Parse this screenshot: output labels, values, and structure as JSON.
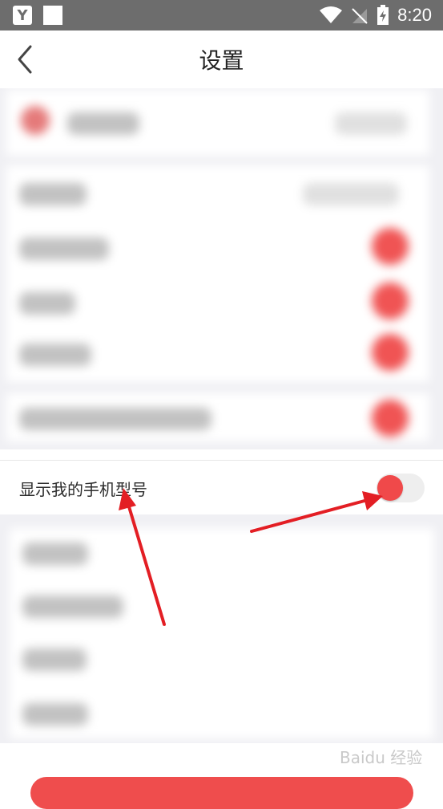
{
  "status_bar": {
    "time": "8:20"
  },
  "header": {
    "title": "设置"
  },
  "privacy_row": {
    "label": "显示我的手机型号",
    "toggle_on": true
  },
  "watermark": {
    "text": "Baidu 经验"
  },
  "colors": {
    "accent": "#f0494a",
    "statusbar": "#6d6d6d"
  }
}
